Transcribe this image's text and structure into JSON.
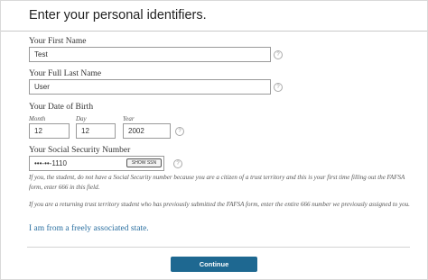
{
  "page": {
    "title": "Enter your personal identifiers."
  },
  "first_name": {
    "label": "Your First Name",
    "value": "Test"
  },
  "last_name": {
    "label": "Your Full Last Name",
    "value": "User"
  },
  "dob": {
    "label": "Your Date of Birth",
    "month_label": "Month",
    "month_value": "12",
    "day_label": "Day",
    "day_value": "12",
    "year_label": "Year",
    "year_value": "2002"
  },
  "ssn": {
    "label": "Your Social Security Number",
    "value": "•••-••-1110",
    "show_button": "SHOW SSN"
  },
  "help_glyph": "?",
  "notes": {
    "note1": "If you, the student, do not have a Social Security number because you are a citizen of a trust territory and this is your first time filling out the FAFSA form, enter 666 in this field.",
    "note2": "If you are a returning trust territory student who has previously submitted the FAFSA form, enter the entire 666 number we previously assigned to you."
  },
  "link": {
    "freely_associated": "I am from a freely associated state."
  },
  "actions": {
    "continue": "Continue"
  },
  "colors": {
    "primary_button": "#1e6891",
    "link": "#2a6fa0"
  },
  "icons": {
    "help": "question-circle-icon"
  }
}
